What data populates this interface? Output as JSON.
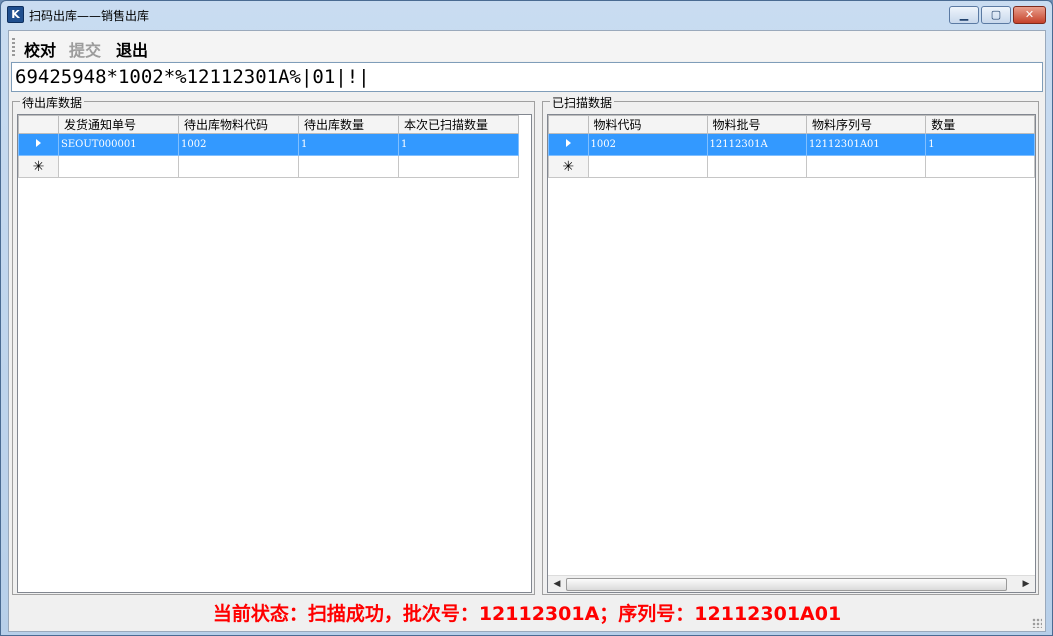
{
  "window": {
    "title": "扫码出库——销售出库",
    "app_icon_glyph": "K",
    "controls": {
      "minimize": "▁",
      "maximize": "▢",
      "close": "✕"
    }
  },
  "toolbar": {
    "check_label": "校对",
    "submit_label": "提交",
    "exit_label": "退出"
  },
  "scan": {
    "value": "69425948*1002*%12112301A%|01|!|"
  },
  "pending": {
    "group_label": "待出库数据",
    "columns": [
      "发货通知单号",
      "待出库物料代码",
      "待出库数量",
      "本次已扫描数量"
    ],
    "rows": [
      {
        "cells": [
          "SEOUT000001",
          "1002",
          "1",
          "1"
        ]
      }
    ],
    "new_row_glyph": "✳"
  },
  "scanned": {
    "group_label": "已扫描数据",
    "columns": [
      "物料代码",
      "物料批号",
      "物料序列号",
      "数量"
    ],
    "rows": [
      {
        "cells": [
          "1002",
          "12112301A",
          "12112301A01",
          "1"
        ]
      }
    ],
    "new_row_glyph": "✳"
  },
  "status": {
    "text": "当前状态：扫描成功，批次号：12112301A；序列号：12112301A01"
  },
  "colors": {
    "selection": "#3399ff",
    "status": "#ff0000"
  },
  "icons": [
    "app-logo-icon",
    "minimize-icon",
    "maximize-icon",
    "close-icon",
    "row-selector-arrow-icon",
    "new-row-star-icon",
    "scroll-left-icon",
    "scroll-right-icon",
    "resize-grip-icon"
  ]
}
